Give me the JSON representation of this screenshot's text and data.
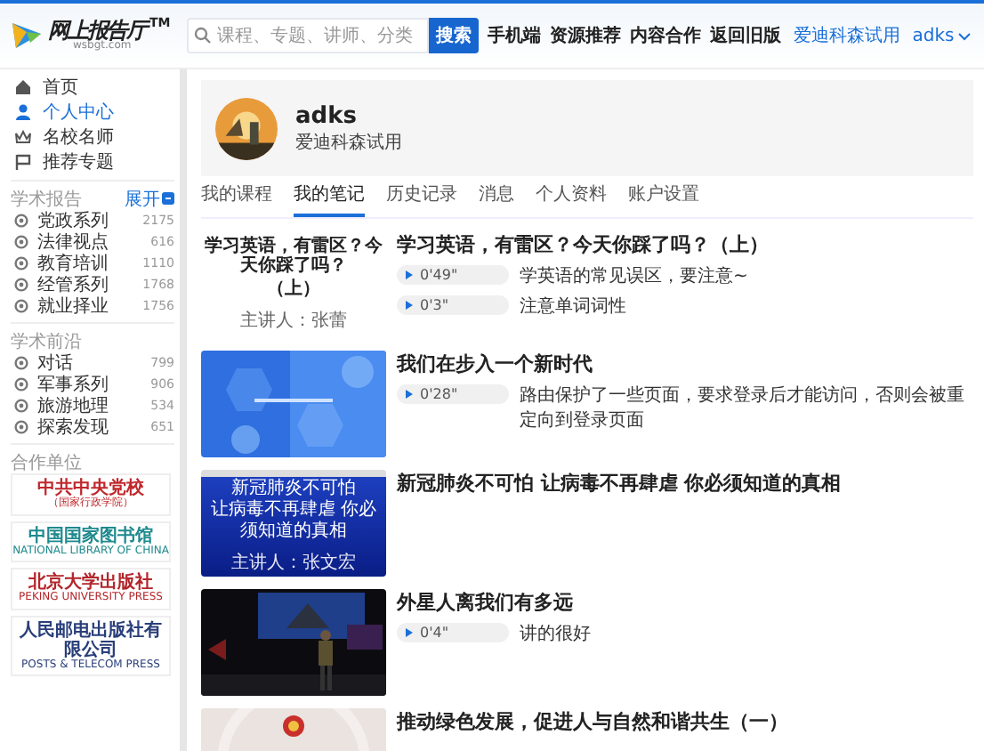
{
  "header": {
    "logo": {
      "name": "网上报告厅",
      "mark": "TM",
      "domain": "wsbgt.com"
    },
    "search": {
      "placeholder": "课程、专题、讲师、分类",
      "button": "搜索"
    },
    "nav": [
      "手机端",
      "资源推荐",
      "内容合作",
      "返回旧版"
    ],
    "trial": "爱迪科森试用",
    "user": "adks"
  },
  "sidebar": {
    "nav": [
      {
        "label": "首页",
        "selected": false
      },
      {
        "label": "个人中心",
        "selected": true
      },
      {
        "label": "名校名师",
        "selected": false
      },
      {
        "label": "推荐专题",
        "selected": false
      }
    ],
    "sections": [
      {
        "title": "学术报告",
        "action": "展开",
        "items": [
          {
            "label": "党政系列",
            "count": "2175"
          },
          {
            "label": "法律视点",
            "count": "616"
          },
          {
            "label": "教育培训",
            "count": "1110"
          },
          {
            "label": "经管系列",
            "count": "1768"
          },
          {
            "label": "就业择业",
            "count": "1756"
          }
        ]
      },
      {
        "title": "学术前沿",
        "items": [
          {
            "label": "对话",
            "count": "799"
          },
          {
            "label": "军事系列",
            "count": "906"
          },
          {
            "label": "旅游地理",
            "count": "534"
          },
          {
            "label": "探索发现",
            "count": "651"
          }
        ]
      }
    ],
    "partners_title": "合作单位",
    "partners": [
      {
        "lines": [
          "中共中央党校",
          "（国家行政学院）"
        ],
        "color": "#c0282d"
      },
      {
        "lines": [
          "中国国家图书馆",
          "NATIONAL LIBRARY OF CHINA"
        ],
        "color": "#1f8a8e"
      },
      {
        "lines": [
          "北京大学出版社",
          "PEKING UNIVERSITY PRESS"
        ],
        "color": "#b2262b"
      },
      {
        "lines": [
          "人民邮电出版社有限公司",
          "POSTS & TELECOM PRESS"
        ],
        "color": "#2a3f7a"
      }
    ]
  },
  "profile": {
    "name": "adks",
    "subtitle": "爱迪科森试用"
  },
  "tabs": [
    {
      "label": "我的课程",
      "selected": false
    },
    {
      "label": "我的笔记",
      "selected": true
    },
    {
      "label": "历史记录",
      "selected": false
    },
    {
      "label": "消息",
      "selected": false
    },
    {
      "label": "个人资料",
      "selected": false
    },
    {
      "label": "账户设置",
      "selected": false
    }
  ],
  "notes": [
    {
      "title": "学习英语，有雷区？今天你踩了吗？（上）",
      "thumbnail": {
        "kind": "light_slide",
        "lines": [
          "学习英语，有雷区？今天你踩了吗？",
          "（上）"
        ],
        "speaker": "主讲人：张蕾"
      },
      "entries": [
        {
          "time": "0'49\"",
          "text": "学英语的常见误区，要注意~"
        },
        {
          "time": "0'3\"",
          "text": "注意单词词性"
        }
      ]
    },
    {
      "title": "我们在步入一个新时代",
      "thumbnail": {
        "kind": "picture"
      },
      "entries": [
        {
          "time": "0'28\"",
          "text": "路由保护了一些页面，要求登录后才能访问，否则会被重定向到登录页面"
        }
      ]
    },
    {
      "title": "新冠肺炎不可怕 让病毒不再肆虐 你必须知道的真相",
      "thumbnail": {
        "kind": "dark_slide",
        "lines": [
          "新冠肺炎不可怕",
          "让病毒不再肆虐 你必须知道的真相"
        ],
        "speaker": "主讲人：张文宏"
      }
    },
    {
      "title": "外星人离我们有多远",
      "thumbnail": {
        "kind": "picture"
      },
      "entries": [
        {
          "time": "0'4\"",
          "text": "讲的很好"
        }
      ]
    },
    {
      "title": "推动绿色发展，促进人与自然和谐共生（一）",
      "thumbnail": {
        "kind": "picture"
      }
    }
  ]
}
